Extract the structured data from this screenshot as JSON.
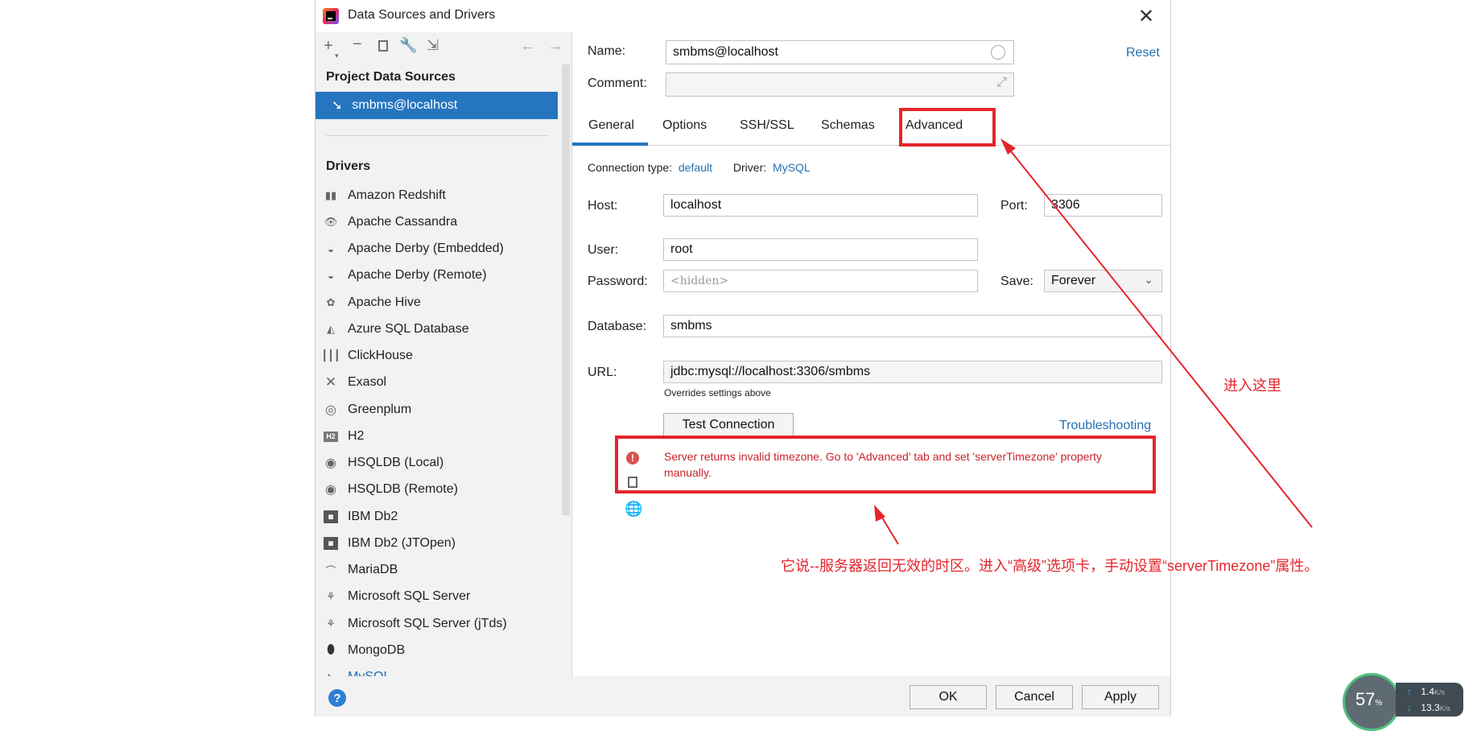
{
  "window": {
    "title": "Data Sources and Drivers"
  },
  "left_panel": {
    "section_title": "Project Data Sources",
    "selected_source": "smbms@localhost",
    "drivers_title": "Drivers",
    "drivers": [
      "Amazon Redshift",
      "Apache Cassandra",
      "Apache Derby (Embedded)",
      "Apache Derby (Remote)",
      "Apache Hive",
      "Azure SQL Database",
      "ClickHouse",
      "Exasol",
      "Greenplum",
      "H2",
      "HSQLDB (Local)",
      "HSQLDB (Remote)",
      "IBM Db2",
      "IBM Db2 (JTOpen)",
      "MariaDB",
      "Microsoft SQL Server",
      "Microsoft SQL Server (jTds)",
      "MongoDB",
      "MySQL"
    ]
  },
  "form": {
    "name_label": "Name:",
    "name_value": "smbms@localhost",
    "comment_label": "Comment:",
    "reset_link": "Reset",
    "tabs": [
      "General",
      "Options",
      "SSH/SSL",
      "Schemas",
      "Advanced"
    ],
    "conn_type_label": "Connection type:",
    "conn_type_value": "default",
    "driver_label": "Driver:",
    "driver_value": "MySQL",
    "host_label": "Host:",
    "host_value": "localhost",
    "port_label": "Port:",
    "port_value": "3306",
    "user_label": "User:",
    "user_value": "root",
    "password_label": "Password:",
    "password_placeholder": "<hidden>",
    "save_label": "Save:",
    "save_value": "Forever",
    "database_label": "Database:",
    "database_value": "smbms",
    "url_label": "URL:",
    "url_value": "jdbc:mysql://localhost:3306/smbms",
    "url_hint": "Overrides settings above",
    "test_button": "Test Connection",
    "troubleshooting": "Troubleshooting",
    "error_message": "Server returns invalid timezone. Go to 'Advanced' tab and set 'serverTimezone' property manually."
  },
  "buttons": {
    "ok": "OK",
    "cancel": "Cancel",
    "apply": "Apply",
    "help": "?"
  },
  "annotations": {
    "enter_here": "进入这里",
    "explanation": "它说--服务器返回无效的时区。进入“高级”选项卡，手动设置“serverTimezone”属性。"
  },
  "overlay": {
    "percent": "57",
    "percent_unit": "%",
    "up_speed": "1.4",
    "down_speed": "13.3",
    "speed_unit": "K/s"
  },
  "colors": {
    "accent": "#2470b3",
    "selection": "#2675bf",
    "annotation": "#e5252c",
    "error": "#c9232a"
  }
}
